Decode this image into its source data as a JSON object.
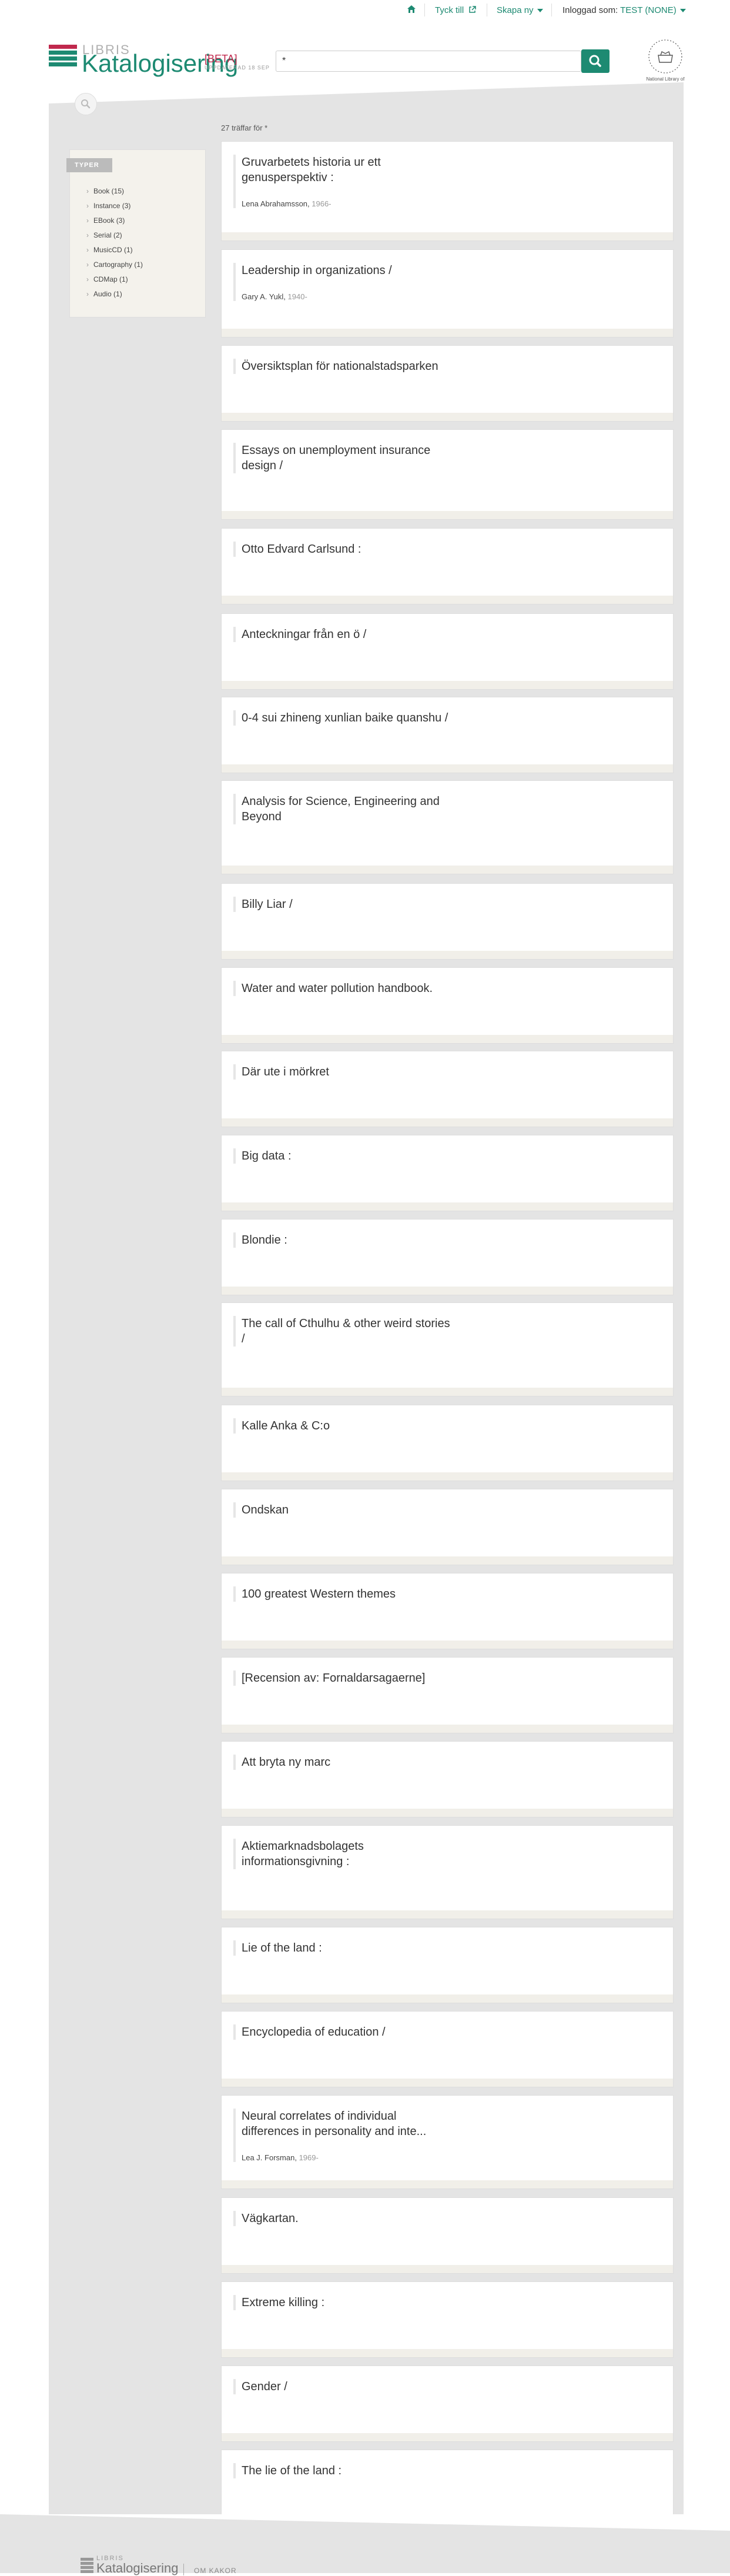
{
  "nav": {
    "home_icon": "home-icon",
    "feedback": "Tyck till",
    "create": "Skapa ny",
    "logged_in_label": "Inloggad som:",
    "logged_in_user": "TEST (NONE)"
  },
  "header": {
    "brand_small": "LIBRIS",
    "brand": "Katalogisering",
    "beta": "[BETA]",
    "beta_sub": "UPPDATERAD 18 SEP",
    "search_value": "*",
    "search_icon": "search-icon",
    "library_logo": "kungliga-biblioteket-logo",
    "library_caption": "National Library of Sweden"
  },
  "results": {
    "count_text": "27 träffar för *",
    "facets_heading": "TYPER",
    "facets": [
      "Book (15)",
      "Instance (3)",
      "EBook (3)",
      "Serial (2)",
      "MusicCD (1)",
      "Cartography (1)",
      "CDMap (1)",
      "Audio (1)"
    ],
    "items": [
      {
        "title": "Gruvarbetets historia ur ett genusperspektiv :",
        "author": "Lena Abrahamsson,",
        "year": "1966-"
      },
      {
        "title": "Leadership in organizations /",
        "author": "Gary A. Yukl,",
        "year": "1940-"
      },
      {
        "title": "Översiktsplan för nationalstadsparken"
      },
      {
        "title": "Essays on unemployment insurance design /"
      },
      {
        "title": "Otto Edvard Carlsund :"
      },
      {
        "title": "Anteckningar från en ö /"
      },
      {
        "title": "0-4 sui zhineng xunlian baike quanshu /"
      },
      {
        "title": "Analysis for Science, Engineering and Beyond"
      },
      {
        "title": "Billy Liar /"
      },
      {
        "title": "Water and water pollution handbook."
      },
      {
        "title": "Där ute i mörkret"
      },
      {
        "title": "Big data :"
      },
      {
        "title": "Blondie :"
      },
      {
        "title": "The call of Cthulhu & other weird stories /"
      },
      {
        "title": "Kalle Anka & C:o"
      },
      {
        "title": "Ondskan"
      },
      {
        "title": "100 greatest Western themes"
      },
      {
        "title": "[Recension av: Fornaldarsagaerne]"
      },
      {
        "title": "Att bryta ny marc"
      },
      {
        "title": "Aktiemarknadsbolagets informationsgivning :"
      },
      {
        "title": "Lie of the land :"
      },
      {
        "title": "Encyclopedia of education /"
      },
      {
        "title": "Neural correlates of individual differences in personality and inte...",
        "author": "Lea J. Forsman,",
        "year": "1969-"
      },
      {
        "title": "Vägkartan."
      },
      {
        "title": "Extreme killing :"
      },
      {
        "title": "Gender /"
      },
      {
        "title": "The lie of the land :"
      }
    ]
  },
  "footer": {
    "brand_small": "LIBRIS",
    "brand": "Katalogisering",
    "about_link": "OM KAKOR"
  },
  "colors": {
    "accent": "#1d8a72",
    "beta": "#c0284d",
    "background": "#e4e4e4"
  }
}
